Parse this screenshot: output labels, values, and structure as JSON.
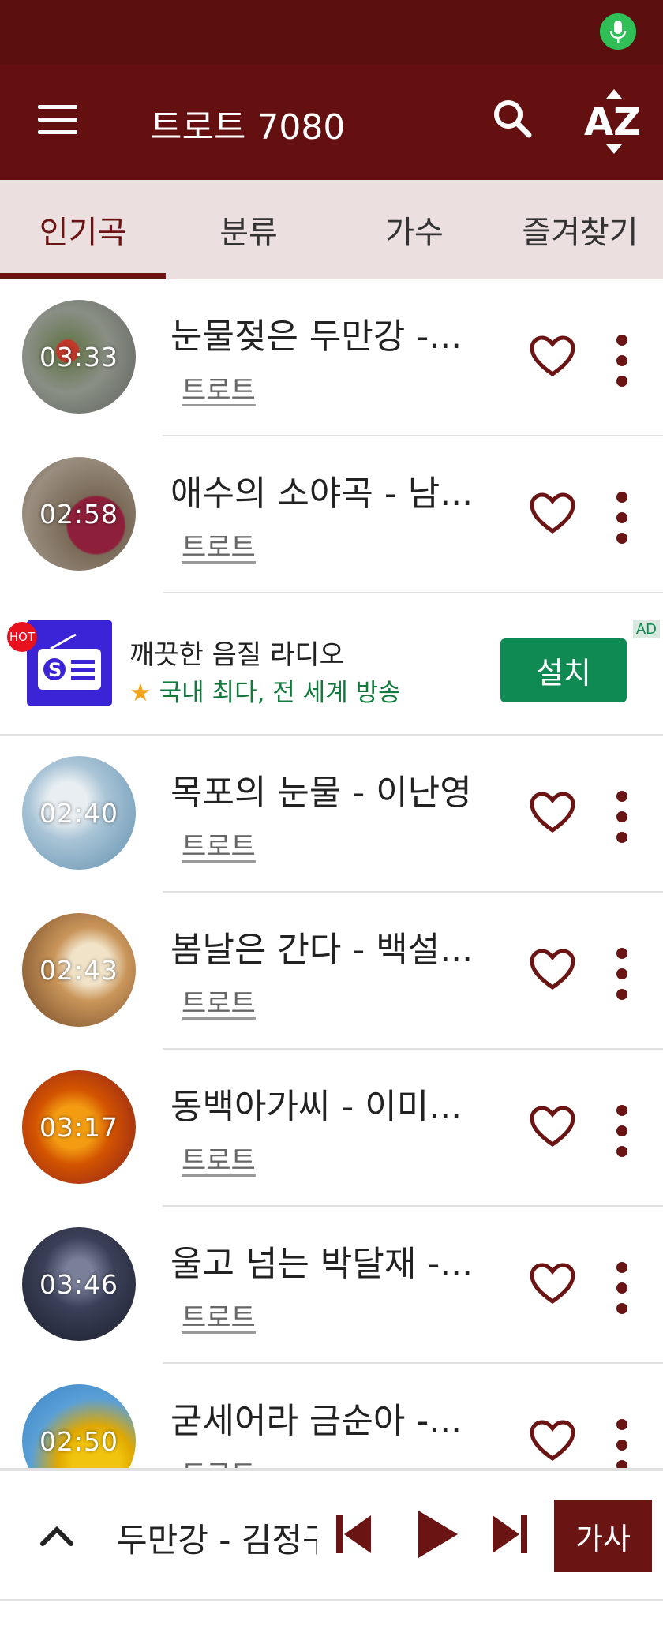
{
  "app": {
    "title": "트로트 7080",
    "accent": "#641010",
    "icons": [
      "menu-icon",
      "search-icon",
      "sort-az-icon",
      "mic-icon"
    ]
  },
  "tabs": [
    {
      "label": "인기곡",
      "active": true
    },
    {
      "label": "분류",
      "active": false
    },
    {
      "label": "가수",
      "active": false
    },
    {
      "label": "즐겨찾기",
      "active": false
    }
  ],
  "songs": [
    {
      "title": "눈물젖은 두만강 -...",
      "duration": "03:33",
      "genre": "트로트"
    },
    {
      "title": "애수의 소야곡 - 남...",
      "duration": "02:58",
      "genre": "트로트"
    },
    {
      "title": "목포의 눈물 - 이난영",
      "duration": "02:40",
      "genre": "트로트"
    },
    {
      "title": "봄날은 간다 - 백설...",
      "duration": "02:43",
      "genre": "트로트"
    },
    {
      "title": "동백아가씨  - 이미...",
      "duration": "03:17",
      "genre": "트로트"
    },
    {
      "title": "울고 넘는 박달재 -...",
      "duration": "03:46",
      "genre": "트로트"
    },
    {
      "title": "굳세어라 금순아 -...",
      "duration": "02:50",
      "genre": "트로트"
    }
  ],
  "ad": {
    "hot": "HOT",
    "title": "깨끗한 음질 라디오",
    "subtitle": "국내 최다, 전 세계 방송",
    "install": "설치",
    "badge": "AD"
  },
  "player": {
    "now_playing": "두만강 - 김정구",
    "lyrics": "가사"
  }
}
